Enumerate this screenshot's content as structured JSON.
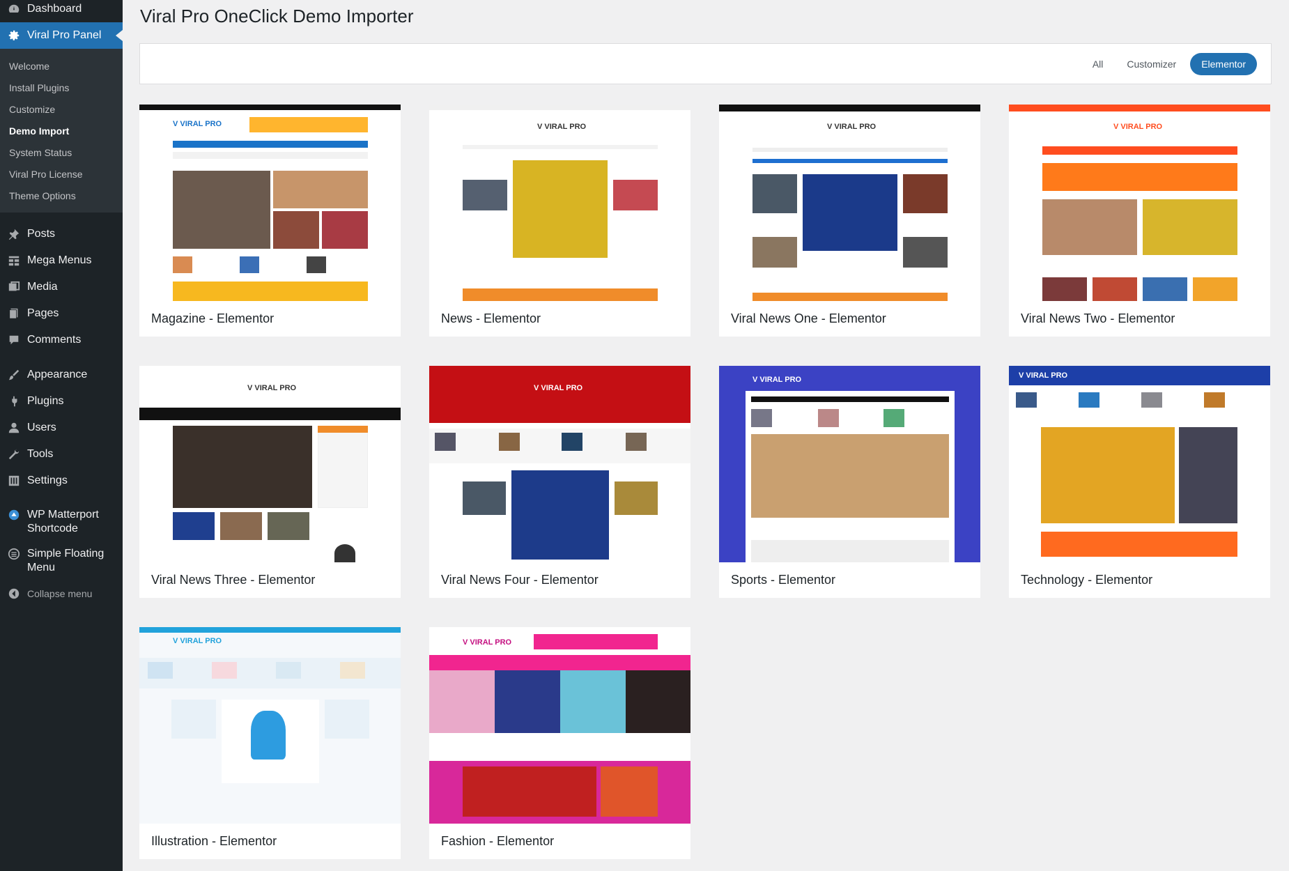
{
  "sidebar": {
    "dashboard": "Dashboard",
    "panel": "Viral Pro Panel",
    "submenu": [
      "Welcome",
      "Install Plugins",
      "Customize",
      "Demo Import",
      "System Status",
      "Viral Pro License",
      "Theme Options"
    ],
    "posts": "Posts",
    "mega_menus": "Mega Menus",
    "media": "Media",
    "pages": "Pages",
    "comments": "Comments",
    "appearance": "Appearance",
    "plugins": "Plugins",
    "users": "Users",
    "tools": "Tools",
    "settings": "Settings",
    "matterport": "WP Matterport Shortcode",
    "floating_menu": "Simple Floating Menu",
    "collapse": "Collapse menu"
  },
  "page": {
    "title": "Viral Pro OneClick Demo Importer"
  },
  "filters": {
    "all": "All",
    "customizer": "Customizer",
    "elementor": "Elementor",
    "active": "Elementor"
  },
  "demos": [
    {
      "label": "Magazine - Elementor",
      "accent": "#1a73c8"
    },
    {
      "label": "News - Elementor",
      "accent": "#e4492d"
    },
    {
      "label": "Viral News One - Elementor",
      "accent": "#1e6fd0"
    },
    {
      "label": "Viral News Two - Elementor",
      "accent": "#ff4d1f"
    },
    {
      "label": "Viral News Three - Elementor",
      "accent": "#111111"
    },
    {
      "label": "Viral News Four - Elementor",
      "accent": "#c40f14"
    },
    {
      "label": "Sports - Elementor",
      "accent": "#3b42c4"
    },
    {
      "label": "Technology - Elementor",
      "accent": "#1d3fa8"
    },
    {
      "label": "Illustration - Elementor",
      "accent": "#21a2db"
    },
    {
      "label": "Fashion - Elementor",
      "accent": "#f1258f"
    }
  ],
  "colors": {
    "sidebar_bg": "#1d2327",
    "active_bg": "#2271b1",
    "submenu_bg": "#2c3338"
  }
}
